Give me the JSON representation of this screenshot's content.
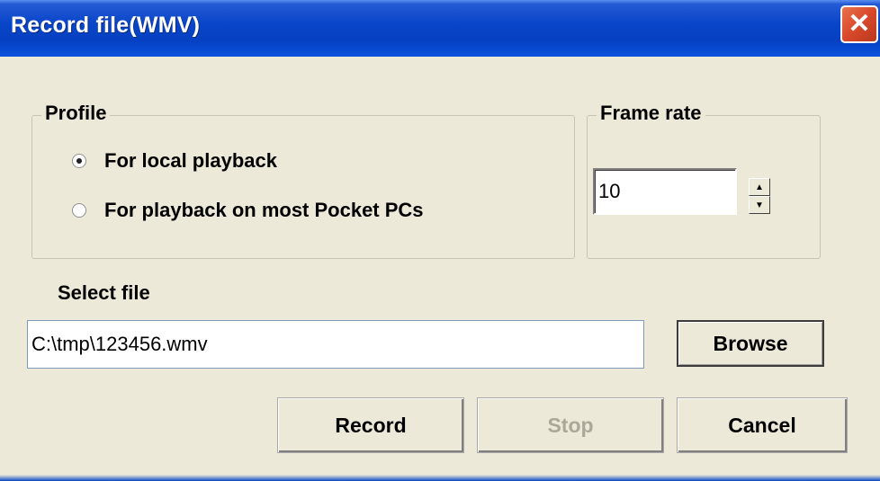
{
  "window": {
    "title": "Record file(WMV)",
    "close_glyph": "✕",
    "close_icon": "close-icon"
  },
  "profile": {
    "legend": "Profile",
    "options": [
      {
        "label": "For local playback",
        "checked": true
      },
      {
        "label": "For playback on most Pocket PCs",
        "checked": false
      }
    ]
  },
  "frame_rate": {
    "legend": "Frame rate",
    "value": "10",
    "up_glyph": "▲",
    "down_glyph": "▼"
  },
  "select_file": {
    "label": "Select file",
    "path": "C:\\tmp\\123456.wmv",
    "browse_label": "Browse"
  },
  "actions": {
    "record_label": "Record",
    "stop_label": "Stop",
    "stop_enabled": false,
    "cancel_label": "Cancel"
  },
  "colors": {
    "titlebar": "#0a46c9",
    "dialog_bg": "#ece9d8",
    "close_button": "#d9482a",
    "disabled_text": "#aca899"
  }
}
